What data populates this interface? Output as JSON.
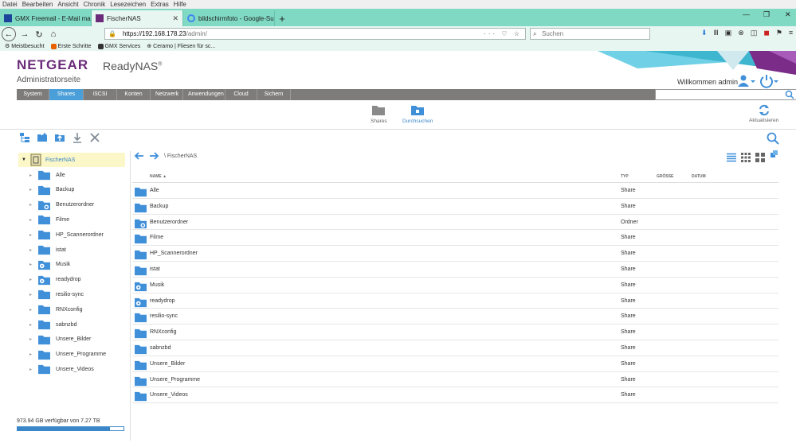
{
  "menubar": [
    "Datei",
    "Bearbeiten",
    "Ansicht",
    "Chronik",
    "Lesezeichen",
    "Extras",
    "Hilfe"
  ],
  "tabs": [
    {
      "label": "GMX Freemail - E-Mail made in",
      "active": false
    },
    {
      "label": "FischerNAS",
      "active": true
    },
    {
      "label": "bildschirmfoto - Google-Suche",
      "active": false
    }
  ],
  "address": {
    "host": "https://192.168.178.23",
    "path": "/admin/"
  },
  "websearch": {
    "placeholder": "Suchen"
  },
  "bookmarks": [
    "Meistbesucht",
    "Erste Schritte",
    "GMX Services",
    "Ceramo | Fliesen für sc..."
  ],
  "header": {
    "logo": "NETGEAR",
    "product": "ReadyNAS",
    "product_mark": "®",
    "subtitle": "Administratorseite",
    "welcome": "Willkommen admin"
  },
  "mainnav": [
    {
      "label": "System",
      "active": false
    },
    {
      "label": "Shares",
      "active": true
    },
    {
      "label": "iSCSI",
      "active": false
    },
    {
      "label": "Konten",
      "active": false
    },
    {
      "label": "Netzwerk",
      "active": false
    },
    {
      "label": "Anwendungen",
      "active": false
    },
    {
      "label": "Cloud",
      "active": false
    },
    {
      "label": "Sichern",
      "active": false
    }
  ],
  "subnav": {
    "shares": "Shares",
    "browse": "Durchsuchen",
    "refresh": "Aktualisieren"
  },
  "tree": {
    "root": "FischerNAS",
    "items": [
      "Alle",
      "Backup",
      "Benutzerordner",
      "Filme",
      "HP_Scannerordner",
      "istat",
      "Musik",
      "readydrop",
      "resilio-sync",
      "RNXconfig",
      "sabnzbd",
      "Unsere_Bilder",
      "Unsere_Programme",
      "Unsere_Videos"
    ]
  },
  "storage": {
    "text": "973.94 GB verfügbar von 7.27 TB",
    "used_fraction": 0.87
  },
  "pathbar": {
    "path": "\\ FischerNAS"
  },
  "table": {
    "headers": {
      "name": "NAME ▲",
      "type": "TYP",
      "size": "GRÖSSE",
      "date": "DATUM"
    },
    "rows": [
      {
        "name": "Alle",
        "type": "Share",
        "icon": "folder-icon"
      },
      {
        "name": "Backup",
        "type": "Share",
        "icon": "folder-icon"
      },
      {
        "name": "Benutzerordner",
        "type": "Ordner",
        "icon": "user-folder-icon"
      },
      {
        "name": "Filme",
        "type": "Share",
        "icon": "folder-icon"
      },
      {
        "name": "HP_Scannerordner",
        "type": "Share",
        "icon": "folder-icon"
      },
      {
        "name": "istat",
        "type": "Share",
        "icon": "folder-icon"
      },
      {
        "name": "Musik",
        "type": "Share",
        "icon": "gear-folder-icon"
      },
      {
        "name": "readydrop",
        "type": "Share",
        "icon": "gear-folder-icon"
      },
      {
        "name": "resilio-sync",
        "type": "Share",
        "icon": "folder-icon"
      },
      {
        "name": "RNXconfig",
        "type": "Share",
        "icon": "folder-icon"
      },
      {
        "name": "sabnzbd",
        "type": "Share",
        "icon": "folder-icon"
      },
      {
        "name": "Unsere_Bilder",
        "type": "Share",
        "icon": "folder-icon"
      },
      {
        "name": "Unsere_Programme",
        "type": "Share",
        "icon": "folder-icon"
      },
      {
        "name": "Unsere_Videos",
        "type": "Share",
        "icon": "folder-icon"
      }
    ]
  },
  "colors": {
    "accent": "#4a9fd8",
    "browser_teal": "#7fd9c3",
    "netgear_purple": "#6b2b7a",
    "nav_gray": "#7d7c7a",
    "folder_blue": "#3f8fd9"
  }
}
